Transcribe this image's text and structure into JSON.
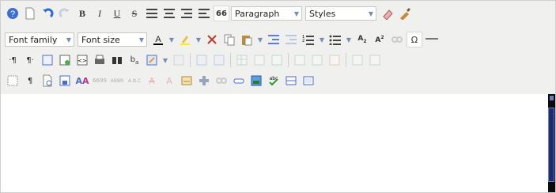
{
  "selects": {
    "format": "Paragraph",
    "styles": "Styles",
    "font_family": "Font family",
    "font_size": "Font size"
  },
  "row1": [
    "help-icon",
    "new-document-icon",
    "undo-icon",
    "redo-icon",
    "bold-icon",
    "italic-icon",
    "underline-icon",
    "strikethrough-icon",
    "align-left-icon",
    "align-center-icon",
    "align-right-icon",
    "align-justify-icon",
    "blockquote-icon"
  ],
  "row1_after_selects": [
    "remove-format-icon",
    "cleanup-icon"
  ],
  "row2_after_selects": [
    "font-color-icon",
    "highlight-icon",
    "cut-icon",
    "copy-icon",
    "paste-icon",
    "outdent-icon",
    "indent-icon",
    "numbered-list-icon",
    "bullet-list-icon",
    "subscript-icon",
    "superscript-icon",
    "link-icon",
    "special-char-icon",
    "horizontal-rule-icon"
  ],
  "colors": {
    "toolbar": "#f0f0ee",
    "border": "#cfcfcf",
    "accent": "#1c2d78"
  }
}
